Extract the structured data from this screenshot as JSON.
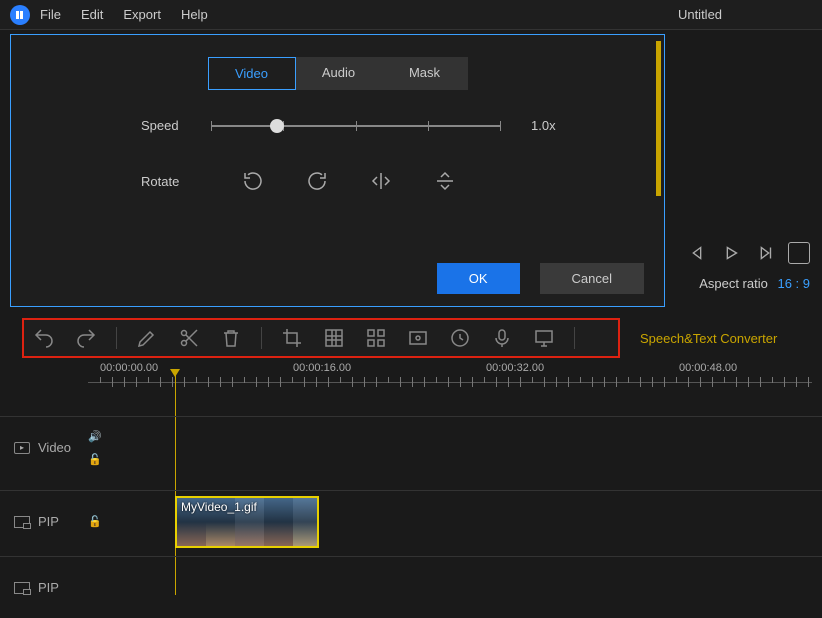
{
  "menubar": {
    "items": [
      "File",
      "Edit",
      "Export",
      "Help"
    ],
    "title": "Untitled"
  },
  "dialog": {
    "tabs": [
      "Video",
      "Audio",
      "Mask"
    ],
    "active_tab": 0,
    "speed_label": "Speed",
    "speed_value": "1.0x",
    "rotate_label": "Rotate",
    "ok_label": "OK",
    "cancel_label": "Cancel"
  },
  "preview": {
    "aspect_label": "Aspect ratio",
    "aspect_value": "16 : 9"
  },
  "toolbar": {
    "speech_text": "Speech&Text Converter"
  },
  "timeline": {
    "labels": [
      "00:00:00.00",
      "00:00:16.00",
      "00:00:32.00",
      "00:00:48.00"
    ]
  },
  "tracks": {
    "video": "Video",
    "pip1": "PIP",
    "pip2": "PIP"
  },
  "clip": {
    "name": "MyVideo_1.gif"
  }
}
